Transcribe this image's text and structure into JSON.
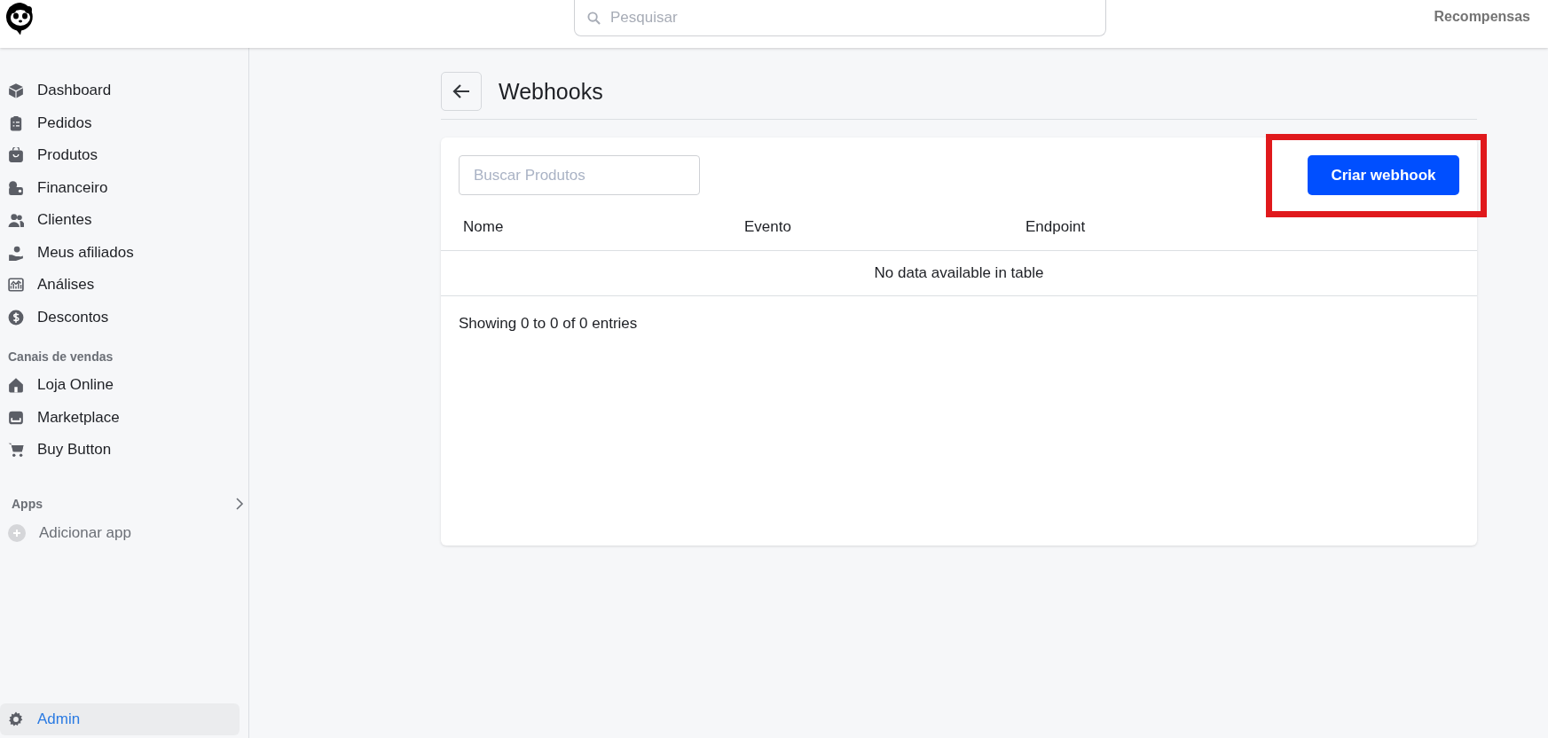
{
  "topbar": {
    "search": {
      "placeholder": "Pesquisar"
    },
    "rewards_link": "Recompensas"
  },
  "sidebar": {
    "items": [
      {
        "label": "Dashboard",
        "selected": false
      },
      {
        "label": "Pedidos",
        "selected": false
      },
      {
        "label": "Produtos",
        "selected": false
      },
      {
        "label": "Financeiro",
        "selected": false
      },
      {
        "label": "Clientes",
        "selected": false
      },
      {
        "label": "Meus afiliados",
        "selected": false
      },
      {
        "label": "Análises",
        "selected": false
      },
      {
        "label": "Descontos",
        "selected": false
      }
    ],
    "sales_channels": {
      "heading": "Canais de vendas",
      "items": [
        {
          "label": "Loja Online",
          "selected": false
        },
        {
          "label": "Marketplace",
          "selected": false
        },
        {
          "label": "Buy Button",
          "selected": false
        }
      ]
    },
    "apps": {
      "heading": "Apps",
      "add_label": "Adicionar app"
    },
    "admin": {
      "label": "Admin",
      "selected": true
    }
  },
  "page": {
    "title": "Webhooks",
    "search": {
      "placeholder": "Buscar Produtos"
    },
    "create_button": "Criar webhook",
    "table": {
      "columns": [
        "Nome",
        "Evento",
        "Endpoint"
      ],
      "empty_message": "No data available in table"
    },
    "footer": "Showing 0 to 0 of 0 entries"
  }
}
